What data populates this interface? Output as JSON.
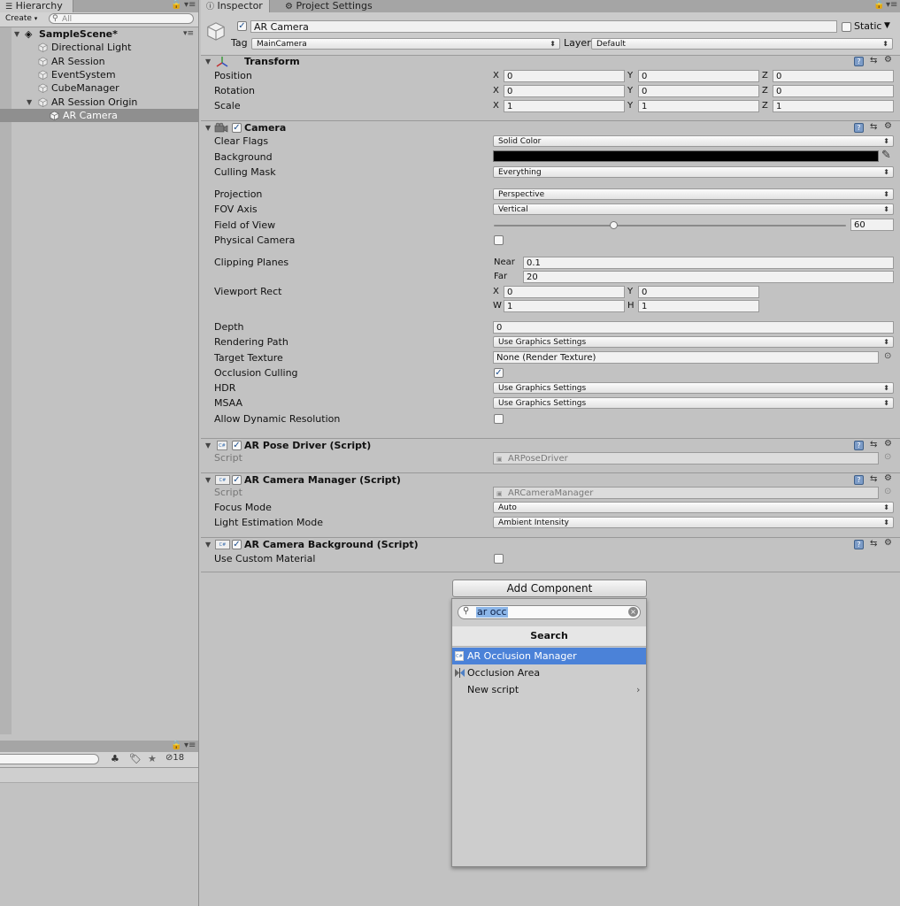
{
  "hierarchy": {
    "tab_label": "Hierarchy",
    "create_label": "Create",
    "search_placeholder": "All",
    "scene_name": "SampleScene*",
    "items": [
      {
        "label": "Directional Light"
      },
      {
        "label": "AR Session"
      },
      {
        "label": "EventSystem"
      },
      {
        "label": "CubeManager"
      },
      {
        "label": "AR Session Origin"
      },
      {
        "label": "AR Camera"
      }
    ],
    "hidden_count": "18"
  },
  "inspector": {
    "tabs": [
      {
        "label": "Inspector"
      },
      {
        "label": "Project Settings"
      }
    ],
    "object_name": "AR Camera",
    "static_label": "Static",
    "tag_label": "Tag",
    "tag_value": "MainCamera",
    "layer_label": "Layer",
    "layer_value": "Default"
  },
  "transform": {
    "title": "Transform",
    "rows": [
      {
        "label": "Position",
        "x": "0",
        "y": "0",
        "z": "0"
      },
      {
        "label": "Rotation",
        "x": "0",
        "y": "0",
        "z": "0"
      },
      {
        "label": "Scale",
        "x": "1",
        "y": "1",
        "z": "1"
      }
    ],
    "axis_x": "X",
    "axis_y": "Y",
    "axis_z": "Z"
  },
  "camera": {
    "title": "Camera",
    "clear_flags_label": "Clear Flags",
    "clear_flags": "Solid Color",
    "background_label": "Background",
    "background_color": "#000000",
    "culling_mask_label": "Culling Mask",
    "culling_mask": "Everything",
    "projection_label": "Projection",
    "projection": "Perspective",
    "fov_axis_label": "FOV Axis",
    "fov_axis": "Vertical",
    "fov_label": "Field of View",
    "fov": "60",
    "fov_fraction": 0.34,
    "physical_label": "Physical Camera",
    "clipping_label": "Clipping Planes",
    "near_label": "Near",
    "near": "0.1",
    "far_label": "Far",
    "far": "20",
    "viewport_label": "Viewport Rect",
    "vx": "0",
    "vy": "0",
    "vw": "1",
    "vh": "1",
    "w_label": "W",
    "h_label": "H",
    "depth_label": "Depth",
    "depth": "0",
    "rendering_path_label": "Rendering Path",
    "rendering_path": "Use Graphics Settings",
    "target_texture_label": "Target Texture",
    "target_texture": "None (Render Texture)",
    "occlusion_label": "Occlusion Culling",
    "hdr_label": "HDR",
    "hdr": "Use Graphics Settings",
    "msaa_label": "MSAA",
    "msaa": "Use Graphics Settings",
    "dyn_res_label": "Allow Dynamic Resolution"
  },
  "pose_driver": {
    "title": "AR Pose Driver (Script)",
    "script_label": "Script",
    "script": "ARPoseDriver"
  },
  "camera_manager": {
    "title": "AR Camera Manager (Script)",
    "script_label": "Script",
    "script": "ARCameraManager",
    "focus_label": "Focus Mode",
    "focus": "Auto",
    "light_label": "Light Estimation Mode",
    "light": "Ambient Intensity"
  },
  "camera_background": {
    "title": "AR Camera Background (Script)",
    "custom_label": "Use Custom Material"
  },
  "add_component": {
    "button_label": "Add Component",
    "search_value": "ar occ",
    "header": "Search",
    "results": [
      {
        "label": "AR Occlusion Manager"
      },
      {
        "label": "Occlusion Area"
      },
      {
        "label": "New script"
      }
    ]
  },
  "colors": {
    "selection_blue": "#4b82d8",
    "hierarchy_selection": "#8f8f8f",
    "panel_bg": "#c2c2c2"
  }
}
